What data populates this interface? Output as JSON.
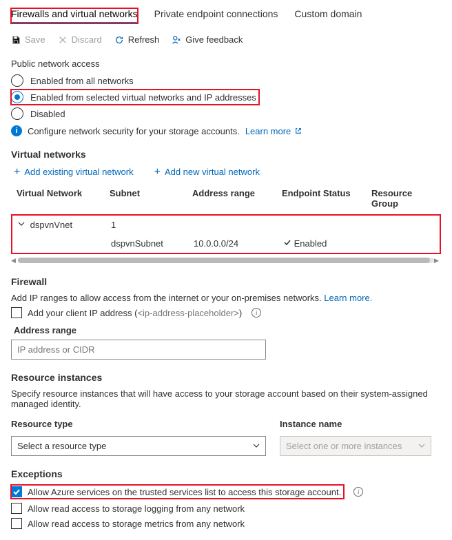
{
  "tabs": {
    "active": "Firewalls and virtual networks",
    "t2": "Private endpoint connections",
    "t3": "Custom domain"
  },
  "toolbar": {
    "save": "Save",
    "discard": "Discard",
    "refresh": "Refresh",
    "feedback": "Give feedback"
  },
  "pna": {
    "title": "Public network access",
    "opt1": "Enabled from all networks",
    "opt2": "Enabled from selected virtual networks and IP addresses",
    "opt3": "Disabled",
    "info": "Configure network security for your storage accounts.",
    "learn": "Learn more"
  },
  "vnet": {
    "title": "Virtual networks",
    "add_existing": "Add existing virtual network",
    "add_new": "Add new virtual network",
    "h1": "Virtual Network",
    "h2": "Subnet",
    "h3": "Address range",
    "h4": "Endpoint Status",
    "h5": "Resource Group",
    "row1": {
      "name": "dspvnVnet",
      "subnet_count": "1"
    },
    "row2": {
      "subnet": "dspvnSubnet",
      "range": "10.0.0.0/24",
      "status": "Enabled"
    }
  },
  "firewall": {
    "title": "Firewall",
    "desc": "Add IP ranges to allow access from the internet or your on-premises networks.",
    "learn": "Learn more.",
    "add_client": "Add your client IP address (",
    "client_ip": "<ip-address-placeholder>",
    "add_client_close": ")",
    "range_label": "Address range",
    "range_ph": "IP address or CIDR"
  },
  "ri": {
    "title": "Resource instances",
    "desc": "Specify resource instances that will have access to your storage account based on their system-assigned managed identity.",
    "type_label": "Resource type",
    "name_label": "Instance name",
    "type_ph": "Select a resource type",
    "name_ph": "Select one or more instances"
  },
  "exc": {
    "title": "Exceptions",
    "opt1": "Allow Azure services on the trusted services list to access this storage account.",
    "opt2": "Allow read access to storage logging from any network",
    "opt3": "Allow read access to storage metrics from any network"
  }
}
